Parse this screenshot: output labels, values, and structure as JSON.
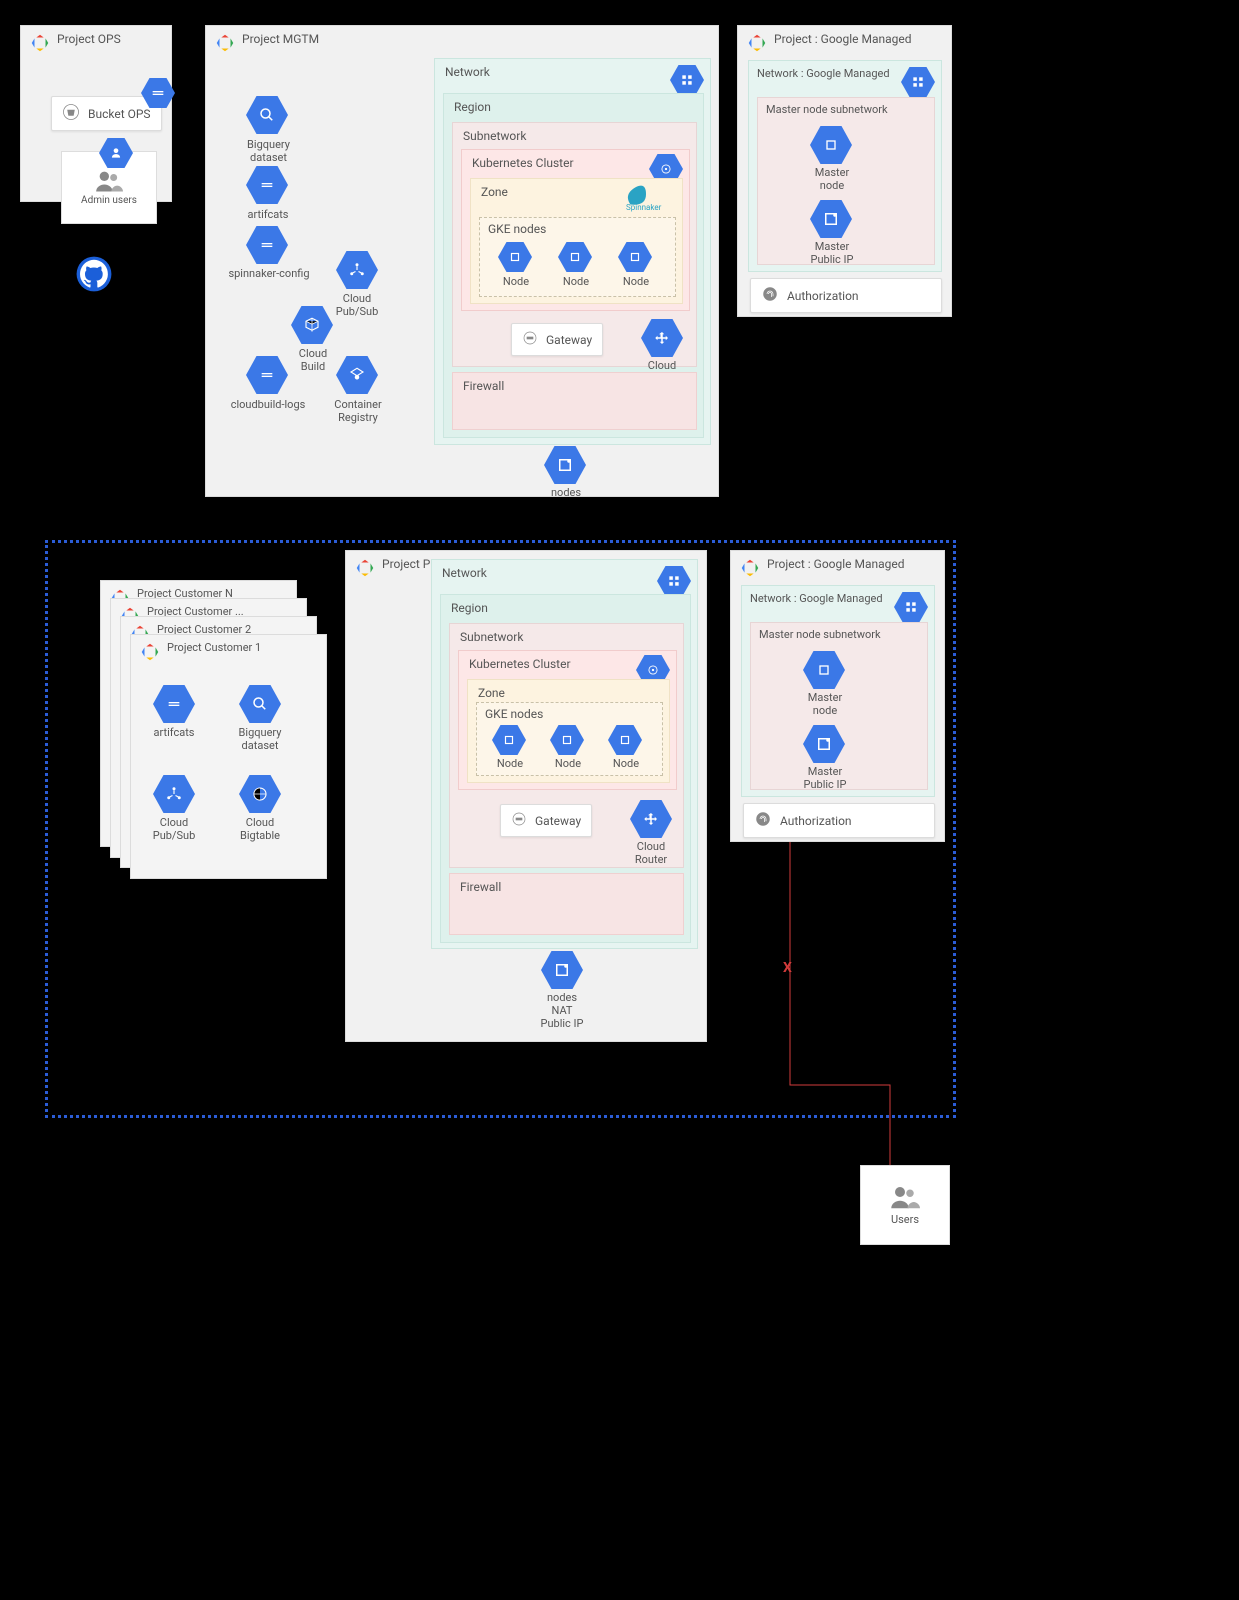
{
  "projects": {
    "ops": {
      "title": "Project OPS",
      "bucket": "Bucket OPS",
      "admin": "Admin users"
    },
    "mgtm": {
      "title": "Project MGTM",
      "network": "Network",
      "region": "Region",
      "subnetwork": "Subnetwork",
      "cluster": "Kubernetes Cluster",
      "zone": "Zone",
      "gke": "GKE nodes",
      "spinnaker_logo": "Spinnaker",
      "nodes": [
        "Node",
        "Node",
        "Node"
      ],
      "gateway": "Gateway",
      "cloud_router": "Cloud\nRouter",
      "firewall": "Firewall",
      "nodes_out": "nodes",
      "left_icons": {
        "bigquery": "Bigquery\ndataset",
        "artifacts": "artifcats",
        "spinnaker_config": "spinnaker-config",
        "cloud_pubsub": "Cloud\nPub/Sub",
        "cloud_build": "Cloud\nBuild",
        "cloudbuild_logs": "cloudbuild-logs",
        "container_registry": "Container\nRegistry"
      }
    },
    "managed_top": {
      "title": "Project : Google Managed",
      "network": "Network : Google Managed",
      "subnet": "Master node subnetwork",
      "master_node": "Master\nnode",
      "master_ip": "Master\nPublic IP",
      "auth": "Authorization"
    },
    "prod": {
      "title": "Project PROD",
      "network": "Network",
      "region": "Region",
      "subnetwork": "Subnetwork",
      "cluster": "Kubernetes Cluster",
      "zone": "Zone",
      "gke": "GKE nodes",
      "nodes": [
        "Node",
        "Node",
        "Node"
      ],
      "gateway": "Gateway",
      "cloud_router": "Cloud\nRouter",
      "firewall": "Firewall",
      "nodes_out": "nodes\nNAT\nPublic IP"
    },
    "managed_bottom": {
      "title": "Project : Google Managed",
      "network": "Network : Google Managed",
      "subnet": "Master node subnetwork",
      "master_node": "Master\nnode",
      "master_ip": "Master\nPublic IP",
      "auth": "Authorization"
    },
    "customers": {
      "stack": [
        "Project Customer N",
        "Project Customer ...",
        "Project Customer 2",
        "Project Customer 1"
      ],
      "artifacts": "artifcats",
      "bigquery": "Bigquery\ndataset",
      "pubsub": "Cloud\nPub/Sub",
      "bigtable": "Cloud\nBigtable"
    }
  },
  "users": "Users",
  "github_icon": "github-icon",
  "colors": {
    "hex": "#3b78e7",
    "dotted": "#2b5cd6",
    "blocked": "#d23b3b",
    "region": "#e6f4f1",
    "subnet": "#f5e9e9",
    "cluster": "#fde7e7",
    "zone": "#fdf3e0"
  }
}
